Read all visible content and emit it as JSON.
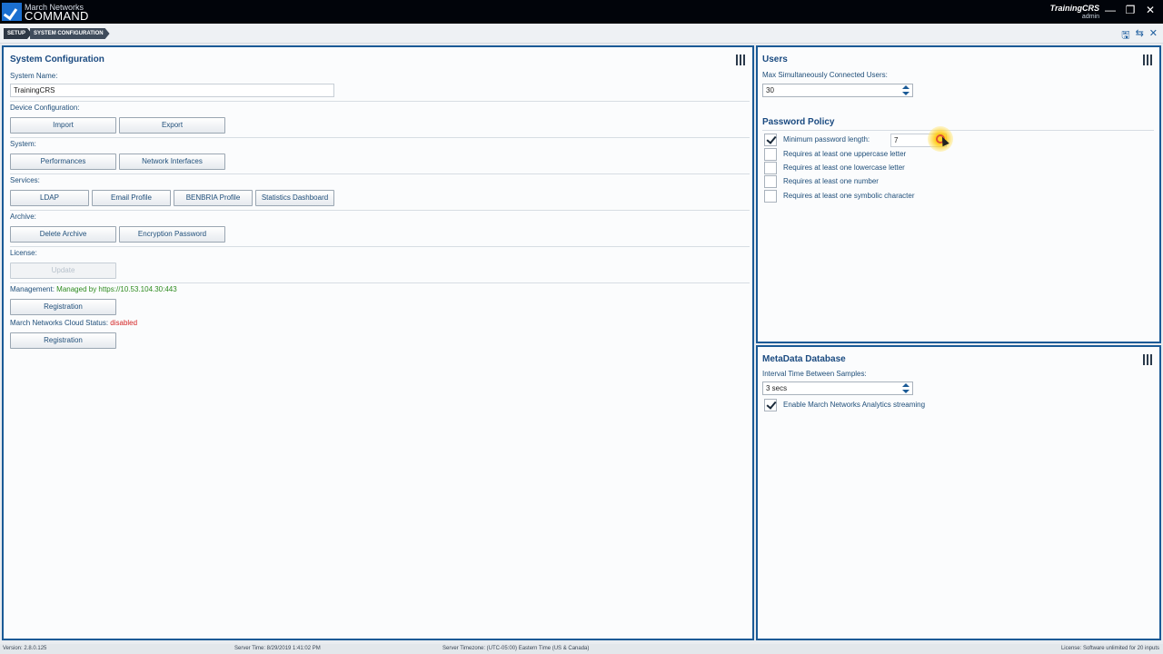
{
  "titlebar": {
    "logo_small": "March Networks",
    "logo_big": "COMMAND",
    "user_name": "TrainingCRS",
    "user_role": "admin",
    "controls": [
      "—",
      "❐",
      "✕"
    ]
  },
  "breadcrumb": [
    "SETUP",
    "SYSTEM CONFIGURATION"
  ],
  "top_actions": {
    "save": "🖫",
    "revert": "⇆",
    "close": "✕"
  },
  "system_config": {
    "title": "System Configuration",
    "system_name_label": "System Name:",
    "system_name_value": "TrainingCRS",
    "device_config_label": "Device Configuration:",
    "import": "Import",
    "export": "Export",
    "system_label": "System:",
    "performances": "Performances",
    "network_interfaces": "Network Interfaces",
    "services_label": "Services:",
    "ldap": "LDAP",
    "email_profile": "Email Profile",
    "benbria_profile": "BENBRIA Profile",
    "statistics_dashboard": "Statistics Dashboard",
    "archive_label": "Archive:",
    "delete_archive": "Delete Archive",
    "encryption_password": "Encryption Password",
    "license_label": "License:",
    "update": "Update",
    "management_label": "Management:",
    "management_value": "Managed by https://10.53.104.30:443",
    "registration_1": "Registration",
    "cloud_status_label": "March Networks Cloud Status:",
    "cloud_status_value": "disabled",
    "registration_2": "Registration"
  },
  "users": {
    "title": "Users",
    "max_users_label": "Max Simultaneously Connected Users:",
    "max_users_value": "30",
    "password_policy_title": "Password Policy",
    "min_length_label": "Minimum password length:",
    "min_length_value": "7",
    "min_length_checked": true,
    "rules": [
      {
        "label": "Requires at least one uppercase letter",
        "checked": false
      },
      {
        "label": "Requires at least one lowercase letter",
        "checked": false
      },
      {
        "label": "Requires at least one number",
        "checked": false
      },
      {
        "label": "Requires at least one symbolic character",
        "checked": false
      }
    ]
  },
  "metadata": {
    "title": "MetaData Database",
    "interval_label": "Interval Time Between Samples:",
    "interval_value": "3 secs",
    "streaming_label": "Enable March Networks Analytics streaming",
    "streaming_checked": true
  },
  "status": {
    "version": "Version:  2.8.0.125",
    "server_time": "Server Time:  8/29/2019 1:41:02 PM",
    "timezone": "Server Timezone:  (UTC-05:00) Eastern Time (US & Canada)",
    "license": "License:  Software unlimited for 20 inputs"
  }
}
